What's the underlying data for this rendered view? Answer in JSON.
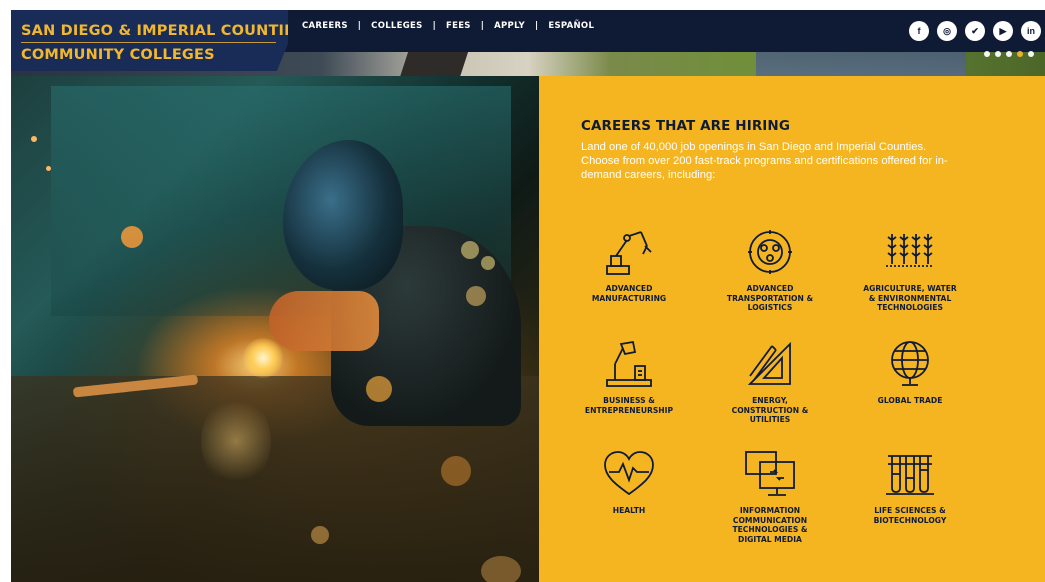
{
  "brand": {
    "line1": "SAN DIEGO & IMPERIAL COUNTIES",
    "line2": "COMMUNITY COLLEGES"
  },
  "nav": {
    "items": [
      {
        "label": "CAREERS"
      },
      {
        "label": "COLLEGES"
      },
      {
        "label": "FEES"
      },
      {
        "label": "APPLY"
      },
      {
        "label": "ESPAÑOL"
      }
    ],
    "separator": "|"
  },
  "social": [
    {
      "icon": "facebook-icon",
      "glyph": "f"
    },
    {
      "icon": "instagram-icon",
      "glyph": "◎"
    },
    {
      "icon": "twitter-icon",
      "glyph": "✔"
    },
    {
      "icon": "youtube-icon",
      "glyph": "▶"
    },
    {
      "icon": "linkedin-icon",
      "glyph": "in"
    }
  ],
  "carousel": {
    "dots": 5,
    "active_index": 3
  },
  "panel": {
    "title": "CAREERS THAT ARE HIRING",
    "intro": "Land one of 40,000 job openings in San Diego and Imperial Counties. Choose from over 200 fast-track programs and certifications offered for in-demand careers, including:",
    "categories": [
      {
        "icon": "robot-arm-icon",
        "label": "ADVANCED\nMANUFACTURING"
      },
      {
        "icon": "engine-icon",
        "label": "ADVANCED\nTRANSPORTATION &\nLOGISTICS"
      },
      {
        "icon": "crops-icon",
        "label": "AGRICULTURE, WATER\n& ENVIRONMENTAL\nTECHNOLOGIES"
      },
      {
        "icon": "desk-lamp-icon",
        "label": "BUSINESS &\nENTREPRENEURSHIP"
      },
      {
        "icon": "drafting-tools-icon",
        "label": "ENERGY,\nCONSTRUCTION &\nUTILITIES"
      },
      {
        "icon": "globe-icon",
        "label": "GLOBAL TRADE"
      },
      {
        "icon": "heart-pulse-icon",
        "label": "HEALTH"
      },
      {
        "icon": "computer-screens-icon",
        "label": "INFORMATION\nCOMMUNICATION\nTECHNOLOGIES &\nDIGITAL MEDIA"
      },
      {
        "icon": "test-tubes-icon",
        "label": "LIFE SCIENCES &\nBIOTECHNOLOGY"
      }
    ]
  },
  "colors": {
    "navy": "#0f1b35",
    "gold": "#f5b521",
    "logo_gold": "#f2b72c"
  }
}
